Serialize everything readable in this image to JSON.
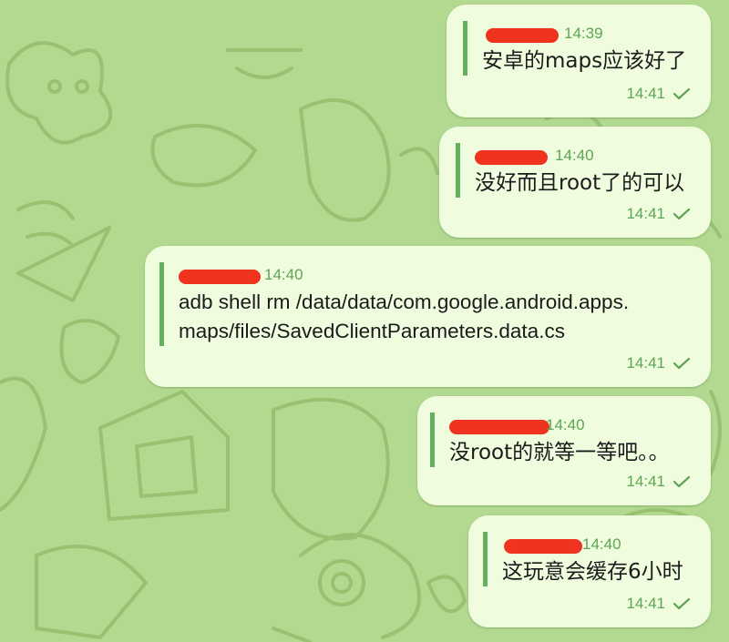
{
  "messages": [
    {
      "reply_time": "14:39",
      "reply_text": "安卓的maps应该好了",
      "time": "14:41",
      "status_icon": "check-icon"
    },
    {
      "reply_time": "14:40",
      "reply_text": "没好而且root了的可以",
      "time": "14:41",
      "status_icon": "check-icon"
    },
    {
      "reply_time": "14:40",
      "reply_text_line1": "adb shell rm /data/data/com.google.android.apps.",
      "reply_text_line2": "maps/files/SavedClientParameters.data.cs",
      "time": "14:41",
      "status_icon": "check-icon"
    },
    {
      "reply_time": "14:40",
      "reply_text": "没root的就等一等吧。。",
      "time": "14:41",
      "status_icon": "check-icon"
    },
    {
      "reply_time": "14:40",
      "reply_text": "这玩意会缓存6小时",
      "time": "14:41",
      "status_icon": "check-icon"
    }
  ],
  "colors": {
    "wallpaper": "#b3d88f",
    "bubble": "#effdde",
    "accent": "#5fa455",
    "reply_bar": "#63b05f",
    "redaction": "#f0331f"
  }
}
